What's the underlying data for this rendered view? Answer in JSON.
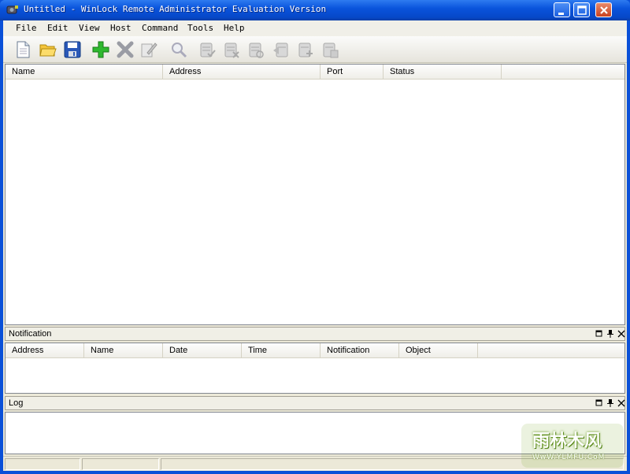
{
  "window": {
    "title": "Untitled - WinLock Remote Administrator Evaluation Version"
  },
  "menu": {
    "items": [
      "File",
      "Edit",
      "View",
      "Host",
      "Command",
      "Tools",
      "Help"
    ]
  },
  "toolbar": {
    "buttons": [
      {
        "icon": "new-document-icon",
        "enabled": true
      },
      {
        "icon": "open-folder-icon",
        "enabled": true
      },
      {
        "icon": "save-icon",
        "enabled": true
      },
      {
        "icon": "add-host-icon",
        "enabled": true
      },
      {
        "icon": "delete-host-icon",
        "enabled": false
      },
      {
        "icon": "edit-host-icon",
        "enabled": false
      },
      {
        "icon": "find-icon",
        "enabled": false
      },
      {
        "icon": "host-connect-icon",
        "enabled": false
      },
      {
        "icon": "host-disconnect-icon",
        "enabled": false
      },
      {
        "icon": "host-refresh-icon",
        "enabled": false
      },
      {
        "icon": "host-send-icon",
        "enabled": false
      },
      {
        "icon": "host-add-icon",
        "enabled": false
      },
      {
        "icon": "host-help-icon",
        "enabled": false
      }
    ]
  },
  "hosts": {
    "columns": [
      "Name",
      "Address",
      "Port",
      "Status"
    ],
    "rows": []
  },
  "notification": {
    "title": "Notification",
    "columns": [
      "Address",
      "Name",
      "Date",
      "Time",
      "Notification",
      "Object"
    ],
    "rows": []
  },
  "log": {
    "title": "Log",
    "entries": []
  },
  "watermark": {
    "main": "雨林木风",
    "sub": "WwW.YLMFU.CoM"
  },
  "colors": {
    "titlebar": "#0a54dc",
    "chrome": "#ece9d8",
    "add_green": "#2fb82f"
  }
}
